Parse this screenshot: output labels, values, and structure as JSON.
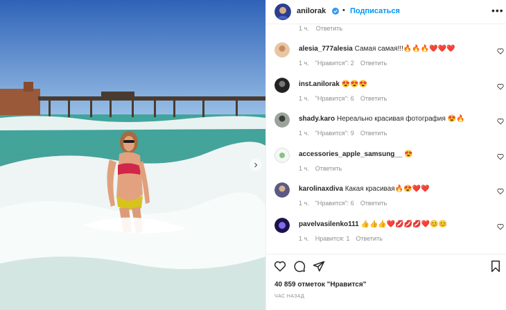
{
  "post": {
    "author": "anilorak",
    "follow_label": "Подписаться",
    "dot": "•",
    "more": "•••",
    "likes": "40 859 отметок \"Нравится\"",
    "time_ago": "ЧАС НАЗАД"
  },
  "top_meta": {
    "time": "1 ч.",
    "reply": "Ответить"
  },
  "comments": [
    {
      "user": "alesia_777alesia",
      "text": "Самая самая!!!🔥🔥🔥❤️❤️❤️",
      "time": "1 ч.",
      "likes": "\"Нравится\": 2",
      "reply": "Ответить"
    },
    {
      "user": "inst.anilorak",
      "text": "😍😍😍",
      "time": "1 ч.",
      "likes": "\"Нравится\": 6",
      "reply": "Ответить"
    },
    {
      "user": "shady.karo",
      "text": "Нереально красивая фотография 😍🔥",
      "time": "1 ч.",
      "likes": "\"Нравится\": 9",
      "reply": "Ответить"
    },
    {
      "user": "accessories_apple_samsung__",
      "text": "😍",
      "time": "1 ч.",
      "likes": "",
      "reply": "Ответить"
    },
    {
      "user": "karolinaxdiva",
      "text": "Какая красивая🔥😍❤️❤️",
      "time": "1 ч.",
      "likes": "\"Нравится\": 6",
      "reply": "Ответить"
    },
    {
      "user": "pavelvasilenko111",
      "text": "👍👍👍❤️💋💋💋❤️😊😊",
      "time": "1 ч.",
      "likes": "Нравится: 1",
      "reply": "Ответить"
    }
  ],
  "icons": {
    "heart": "heart-icon",
    "comment": "comment-icon",
    "share": "share-icon",
    "save": "bookmark-icon",
    "verified": "verified-icon"
  },
  "colors": {
    "accent": "#0095f6",
    "muted": "#8e8e8e",
    "verified": "#3897f0"
  }
}
